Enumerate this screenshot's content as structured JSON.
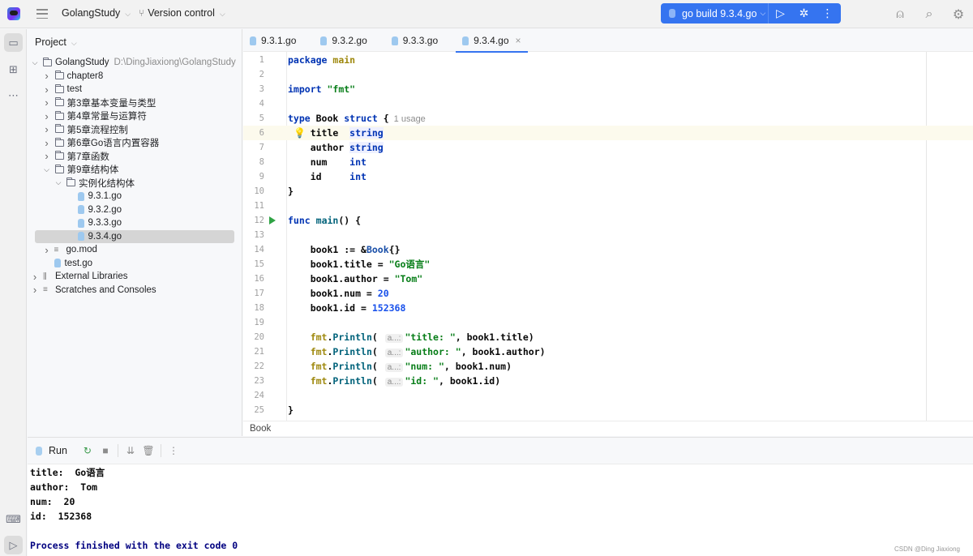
{
  "titlebar": {
    "project_name": "GolangStudy",
    "vcs_label": "Version control",
    "run_config": "go build 9.3.4.go",
    "icons": [
      "app-logo-icon",
      "main-menu-icon",
      "branch-icon",
      "run-icon",
      "debug-icon",
      "more-icon",
      "add-user-icon",
      "search-icon",
      "settings-icon"
    ]
  },
  "left_strip": {
    "icons": [
      "project-icon",
      "structure-icon",
      "more-icon",
      "terminal-icon",
      "run-icon"
    ]
  },
  "project_pane": {
    "title": "Project",
    "tree": [
      {
        "label": "GolangStudy",
        "hint": "D:\\DingJiaxiong\\GolangStudy",
        "depth": 0,
        "type": "folder",
        "expanded": true
      },
      {
        "label": "chapter8",
        "depth": 1,
        "type": "folder",
        "expanded": false
      },
      {
        "label": "test",
        "depth": 1,
        "type": "folder",
        "expanded": false
      },
      {
        "label": "第3章基本变量与类型",
        "depth": 1,
        "type": "folder",
        "expanded": false
      },
      {
        "label": "第4章常量与运算符",
        "depth": 1,
        "type": "folder",
        "expanded": false
      },
      {
        "label": "第5章流程控制",
        "depth": 1,
        "type": "folder",
        "expanded": false
      },
      {
        "label": "第6章Go语言内置容器",
        "depth": 1,
        "type": "folder",
        "expanded": false
      },
      {
        "label": "第7章函数",
        "depth": 1,
        "type": "folder",
        "expanded": false
      },
      {
        "label": "第9章结构体",
        "depth": 1,
        "type": "folder",
        "expanded": true
      },
      {
        "label": "实例化结构体",
        "depth": 2,
        "type": "folder",
        "expanded": true
      },
      {
        "label": "9.3.1.go",
        "depth": 3,
        "type": "go"
      },
      {
        "label": "9.3.2.go",
        "depth": 3,
        "type": "go"
      },
      {
        "label": "9.3.3.go",
        "depth": 3,
        "type": "go"
      },
      {
        "label": "9.3.4.go",
        "depth": 3,
        "type": "go",
        "selected": true
      },
      {
        "label": "go.mod",
        "depth": 1,
        "type": "mod",
        "expanded": false
      },
      {
        "label": "test.go",
        "depth": 1,
        "type": "go"
      },
      {
        "label": "External Libraries",
        "depth": 0,
        "type": "lib",
        "expanded": false
      },
      {
        "label": "Scratches and Consoles",
        "depth": 0,
        "type": "scratch",
        "expanded": false
      }
    ]
  },
  "editor": {
    "tabs": [
      {
        "label": "9.3.1.go",
        "active": false
      },
      {
        "label": "9.3.2.go",
        "active": false
      },
      {
        "label": "9.3.3.go",
        "active": false
      },
      {
        "label": "9.3.4.go",
        "active": true
      }
    ],
    "close_glyph": "×",
    "usage_hint": "1 usage",
    "inlay_hint": "a...:",
    "current_line": 6,
    "run_gutter_line": 12,
    "lines": [
      "package main",
      "",
      "import \"fmt\"",
      "",
      "type Book struct {",
      "\ttitle  string",
      "\tauthor string",
      "\tnum    int",
      "\tid     int",
      "}",
      "",
      "func main() {",
      "",
      "\tbook1 := &Book{}",
      "\tbook1.title = \"Go语言\"",
      "\tbook1.author = \"Tom\"",
      "\tbook1.num = 20",
      "\tbook1.id = 152368",
      "",
      "\tfmt.Println(\"title: \", book1.title)",
      "\tfmt.Println(\"author: \", book1.author)",
      "\tfmt.Println(\"num: \", book1.num)",
      "\tfmt.Println(\"id: \", book1.id)",
      "",
      "}"
    ],
    "breadcrumb": "Book"
  },
  "run_panel": {
    "tab_label": "Run",
    "toolbar_icons": [
      "rerun-icon",
      "stop-icon",
      "scroll-to-end-icon",
      "clear-icon",
      "more-icon"
    ],
    "output": [
      "title:  Go语言",
      "author:  Tom",
      "num:  20",
      "id:  152368",
      "",
      "Process finished with the exit code 0"
    ]
  },
  "watermark": "CSDN @Ding Jiaxiong",
  "colors": {
    "accent": "#3574f0",
    "keyword": "#0033b3",
    "string": "#067d17",
    "number": "#1750eb",
    "package": "#9e880d",
    "exit_text": "#000080",
    "run_gutter": "#2fa344"
  }
}
